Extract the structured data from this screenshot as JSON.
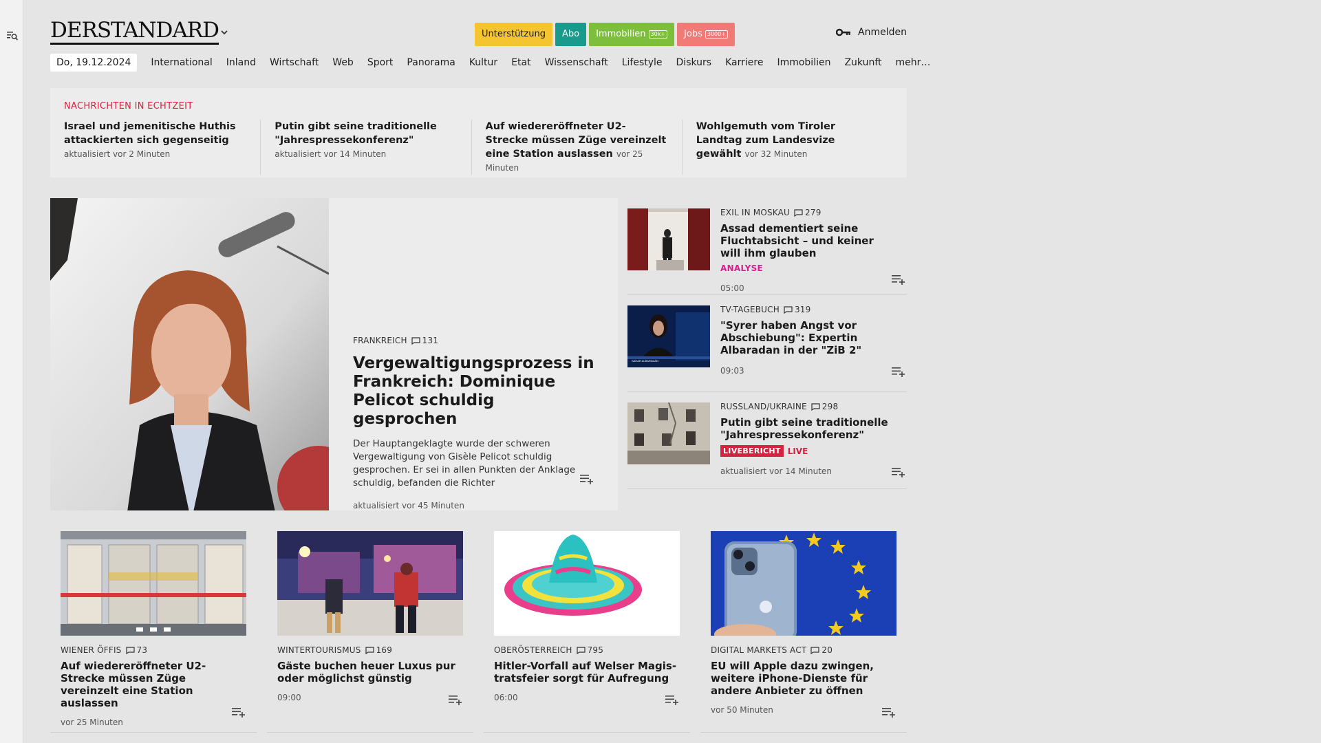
{
  "brand": {
    "logo": "DERSTANDARD"
  },
  "header": {
    "buttons": [
      {
        "label": "Unterstützung",
        "bg": "#f5c531",
        "fg": "#1a1a1a"
      },
      {
        "label": "Abo",
        "bg": "#1a9a8c",
        "fg": "#ffffff"
      },
      {
        "label": "Immobilien",
        "badge": "30k+",
        "bg": "#7dbe3c",
        "fg": "#ffffff"
      },
      {
        "label": "Jobs",
        "badge": "3000+",
        "bg": "#f07a75",
        "fg": "#ffffff"
      }
    ],
    "login": "Anmelden"
  },
  "nav": {
    "date": "Do, 19.12.2024",
    "items": [
      "International",
      "Inland",
      "Wirtschaft",
      "Web",
      "Sport",
      "Panorama",
      "Kultur",
      "Etat",
      "Wissenschaft",
      "Lifestyle",
      "Diskurs",
      "Karriere",
      "Immobilien",
      "Zukunft",
      "mehr…"
    ]
  },
  "realtime": {
    "title": "NACHRICHTEN IN ECHTZEIT",
    "items": [
      {
        "headline": "Israel und jemenitische Huthis atta­ckierten sich gegenseitig",
        "meta": "aktualisiert vor 2 Minuten"
      },
      {
        "headline": "Putin gibt seine traditionelle \"Jahres­pressekonferenz\"",
        "meta": "aktualisiert vor 14 Minuten"
      },
      {
        "headline": "Auf wiedereröffneter U2-Strecke müs­sen Züge vereinzelt eine Station aus­lassen",
        "meta": "vor 25 Minuten"
      },
      {
        "headline": "Wohlgemuth vom Tiroler Landtag zum Landesvize gewählt",
        "meta": "vor 32 Minuten"
      }
    ]
  },
  "lead": {
    "kicker": "FRANKREICH",
    "comments": "131",
    "title": "Vergewaltigungsprozess in Frankreich: Dominique Pelicot schuldig gesprochen",
    "teaser": "Der Hauptangeklagte wurde der schweren Vergewaltigung von Gisèle Pelicot schuldig gesprochen. Er sei in allen Punkten der Anklage schuldig, befanden die Richter",
    "meta": "aktualisiert vor 45 Minuten"
  },
  "side": [
    {
      "kicker": "EXIL IN MOSKAU",
      "comments": "279",
      "title": "Assad dementiert seine Fluchtabsicht – und keiner will ihm glauben",
      "label": "ANALYSE",
      "time": "05:00"
    },
    {
      "kicker": "TV-TAGEBUCH",
      "comments": "319",
      "title": "\"Syrer haben Angst vor Abschiebung\": Expertin Albaradan in der \"ZiB 2\"",
      "time": "09:03",
      "caption": "SAHAR ALBARADAN"
    },
    {
      "kicker": "RUSSLAND/UKRAINE",
      "comments": "298",
      "title": "Putin gibt seine traditionelle \"Jahrespressekonferenz\"",
      "live_badge": "LIVEBERICHT",
      "live_text": "LIVE",
      "time": "aktualisiert vor 14 Minuten"
    }
  ],
  "cards": [
    {
      "kicker": "WIENER ÖFFIS",
      "comments": "73",
      "title": "Auf wiedereröffneter U2-Strecke müssen Züge vereinzelt eine Station auslassen",
      "time": "vor 25 Minuten"
    },
    {
      "kicker": "WINTERTOURISMUS",
      "comments": "169",
      "title": "Gäste buchen heuer Luxus pur oder möglichst günstig",
      "time": "09:00"
    },
    {
      "kicker": "OBERÖSTERREICH",
      "comments": "795",
      "title": "Hitler-Vorfall auf Welser Magis­tratsfeier sorgt für Aufregung",
      "time": "06:00"
    },
    {
      "kicker": "DIGITAL MARKETS ACT",
      "comments": "20",
      "title": "EU will Apple dazu zwingen, weitere iPhone-Dienste für andere Anbieter zu öffnen",
      "time": "vor 50 Minuten"
    }
  ],
  "colors": {
    "live": "#d6223f",
    "analyse": "#d4218f"
  }
}
